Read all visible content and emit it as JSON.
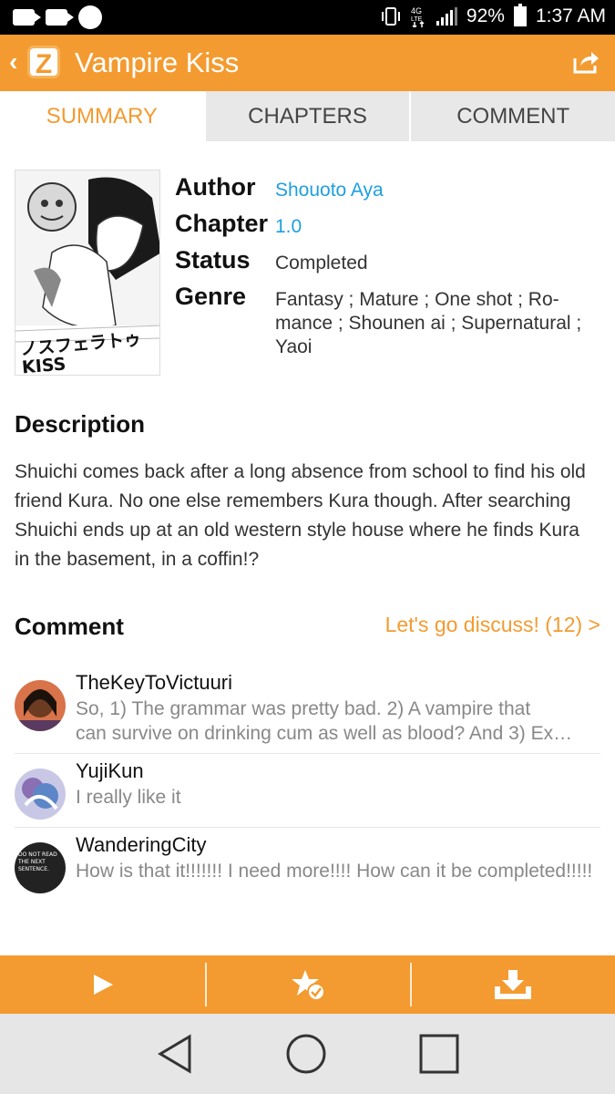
{
  "status_bar": {
    "battery": "92%",
    "time": "1:37 AM",
    "network": "4G LTE"
  },
  "app_bar": {
    "logo": "Z",
    "back": "‹",
    "title": "Vampire Kiss",
    "share_icon": "share-icon"
  },
  "tabs": [
    {
      "label": "SUMMARY",
      "active": true
    },
    {
      "label": "CHAPTERS",
      "active": false
    },
    {
      "label": "COMMENT",
      "active": false
    }
  ],
  "cover": {
    "title_art": "ノスフェラトゥ KISS"
  },
  "info": {
    "author_label": "Author",
    "author_value": "Shouoto Aya",
    "chapter_label": "Chapter",
    "chapter_value": "1.0",
    "status_label": "Status",
    "status_value": "Completed",
    "genre_label": "Genre",
    "genre_value": "Fantasy ; Mature ; One shot ; Ro-mance ; Shounen ai ; Supernatural ; Yaoi"
  },
  "description": {
    "title": "Description",
    "text": "Shuichi comes back after a long absence from school to find his old friend Kura. No one else remembers Kura though. After searching Shuichi ends up at an old western style house where he finds Kura in the basement, in a coffin!?"
  },
  "comments_section": {
    "title": "Comment",
    "discuss_link": "Let's go discuss! (12) >",
    "items": [
      {
        "user": "TheKeyToVictuuri",
        "text": "So, 1) The grammar was pretty bad. 2) A vampire that",
        "text2": "can survive on drinking cum as well as blood? And 3) Ex…"
      },
      {
        "user": "YujiKun",
        "text": "I really like it"
      },
      {
        "user": "WanderingCity",
        "text": "How is that it!!!!!!! I need more!!!! How can it be completed!!!!!",
        "avatar_text": "DO NOT READ THE NEXT SENTENCE."
      }
    ]
  },
  "bottom_bar": {
    "icons": [
      "play-icon",
      "favorite-icon",
      "download-icon"
    ]
  },
  "nav_bar": {
    "icons": [
      "back-nav-icon",
      "home-nav-icon",
      "recents-nav-icon"
    ]
  },
  "colors": {
    "accent": "#f39b30",
    "link": "#1e9fe0"
  }
}
